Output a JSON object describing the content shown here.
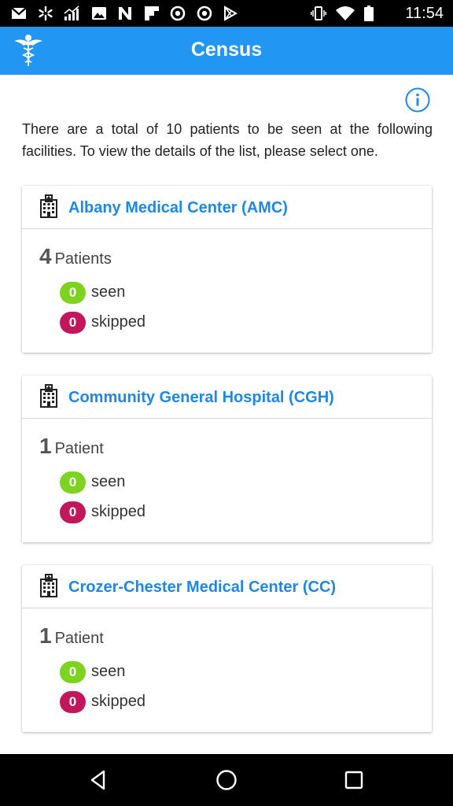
{
  "status_bar": {
    "time": "11:54",
    "left_icons": [
      "gmail-icon",
      "asterisk-icon",
      "signal-chart-icon",
      "image-icon",
      "n-logo-icon",
      "flipboard-icon",
      "target-icon",
      "target-icon",
      "play-store-icon"
    ],
    "right_icons": [
      "vibrate-icon",
      "wifi-icon",
      "battery-icon"
    ]
  },
  "app_bar": {
    "title": "Census",
    "logo_icon": "caduceus-icon",
    "color": "#2196f3"
  },
  "info_icon": "info-icon",
  "intro_text": "There are a total of 10 patients to be seen at the following facilities. To view the details of the list, please select one.",
  "facilities": [
    {
      "name": "Albany Medical Center (AMC)",
      "count": "4",
      "count_label": "Patients",
      "seen_count": "0",
      "seen_label": "seen",
      "skipped_count": "0",
      "skipped_label": "skipped"
    },
    {
      "name": "Community General Hospital (CGH)",
      "count": "1",
      "count_label": "Patient",
      "seen_count": "0",
      "seen_label": "seen",
      "skipped_count": "0",
      "skipped_label": "skipped"
    },
    {
      "name": "Crozer-Chester Medical Center (CC)",
      "count": "1",
      "count_label": "Patient",
      "seen_count": "0",
      "seen_label": "seen",
      "skipped_count": "0",
      "skipped_label": "skipped"
    }
  ],
  "colors": {
    "accent": "#2196f3",
    "link": "#1e88e5",
    "seen_badge": "#7ed321",
    "skipped_badge": "#c2185b"
  },
  "nav_bar": {
    "buttons": [
      "back-icon",
      "home-icon",
      "recents-icon"
    ]
  }
}
